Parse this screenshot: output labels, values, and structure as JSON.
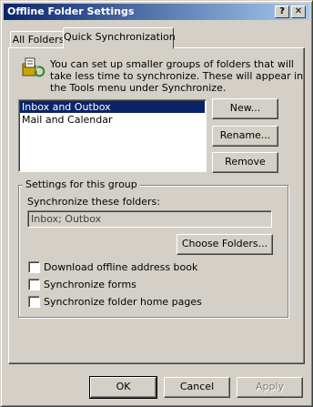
{
  "window": {
    "title": "Offline Folder Settings",
    "help_glyph": "?",
    "close_glyph": "✕"
  },
  "tabs": [
    {
      "label": "All Folders"
    },
    {
      "label": "Quick Synchronization"
    }
  ],
  "intro": {
    "lines": [
      "You can set up smaller groups of folders that will",
      "take less time to synchronize.  These will appear in",
      "the Tools menu under Synchronize."
    ]
  },
  "groups_list": {
    "items": [
      "Inbox and Outbox",
      "Mail and Calendar"
    ],
    "selected": 0
  },
  "group_buttons": {
    "new_label": "New...",
    "rename_label": "Rename...",
    "remove_label": "Remove"
  },
  "settings": {
    "group_label": "Settings for this group",
    "sync_folders_label": "Synchronize these folders:",
    "sync_folders_value": "Inbox; Outbox",
    "choose_folders_label": "Choose Folders...",
    "options": [
      {
        "label": "Download offline address book",
        "checked": false
      },
      {
        "label": "Synchronize forms",
        "checked": false
      },
      {
        "label": "Synchronize folder home pages",
        "checked": false
      }
    ]
  },
  "dialog_buttons": {
    "ok_label": "OK",
    "cancel_label": "Cancel",
    "apply_label": "Apply"
  }
}
